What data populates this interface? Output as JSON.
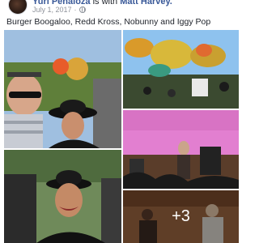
{
  "post": {
    "author": "Yuri Peñaloza",
    "is_with": "is with",
    "tagged": "Matt Harvey.",
    "date": "July 1, 2017",
    "date_separator": "·",
    "privacy_icon": "globe-icon",
    "text": "Burger Boogaloo, Redd Kross, Nobunny and Iggy Pop"
  },
  "gallery": {
    "photos": [
      {
        "name": "selfie-photo"
      },
      {
        "name": "parade-balloons-photo"
      },
      {
        "name": "concert-stage-photo"
      },
      {
        "name": "woman-hat-photo"
      },
      {
        "name": "more-photos-tile"
      }
    ],
    "more_count": "+3"
  },
  "colors": {
    "link": "#385898",
    "text": "#1d2129",
    "meta": "#90949c"
  }
}
